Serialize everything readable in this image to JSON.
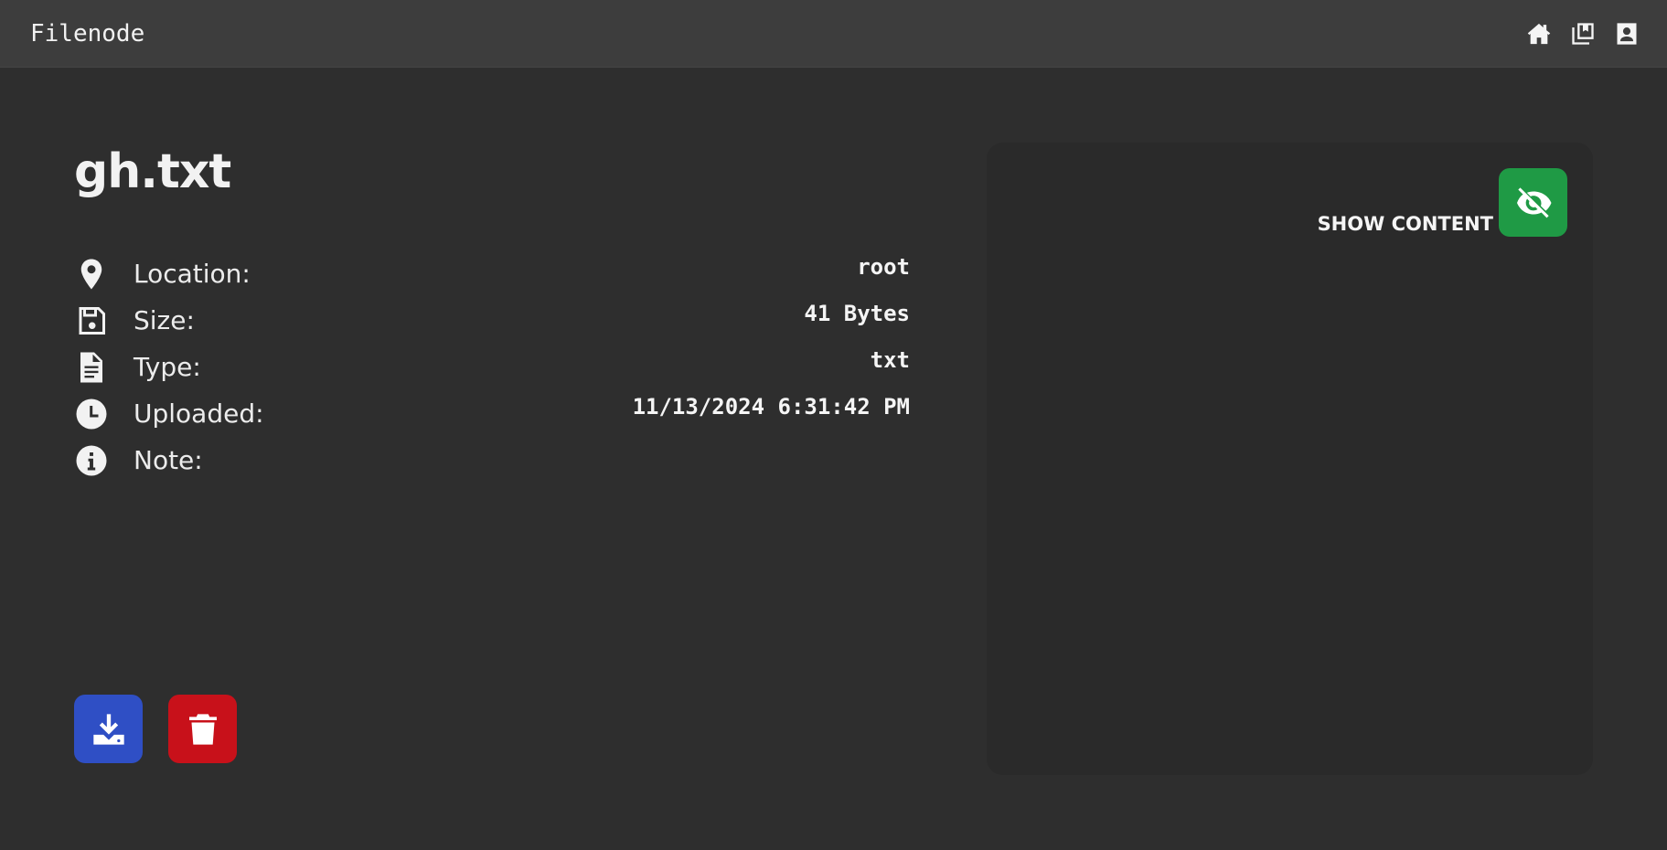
{
  "navbar": {
    "brand": "Filenode",
    "icons": [
      "home-icon",
      "library-icon",
      "account-icon"
    ]
  },
  "file": {
    "name": "gh.txt"
  },
  "details": [
    {
      "icon": "location-pin-icon",
      "label": "Location:",
      "value": "root"
    },
    {
      "icon": "floppy-disk-icon",
      "label": "Size:",
      "value": "41 Bytes"
    },
    {
      "icon": "file-text-icon",
      "label": "Type:",
      "value": "txt"
    },
    {
      "icon": "clock-icon",
      "label": "Uploaded:",
      "value": "11/13/2024 6:31:42 PM"
    },
    {
      "icon": "info-circle-icon",
      "label": "Note:",
      "value": ""
    }
  ],
  "actions": {
    "download_icon": "download-icon",
    "delete_icon": "trash-icon",
    "download_color": "#2f4fc5",
    "delete_color": "#c8111a"
  },
  "content_panel": {
    "show_label": "SHOW CONTENT",
    "toggle_icon": "eye-slash-icon",
    "toggle_color": "#1f9a45"
  }
}
